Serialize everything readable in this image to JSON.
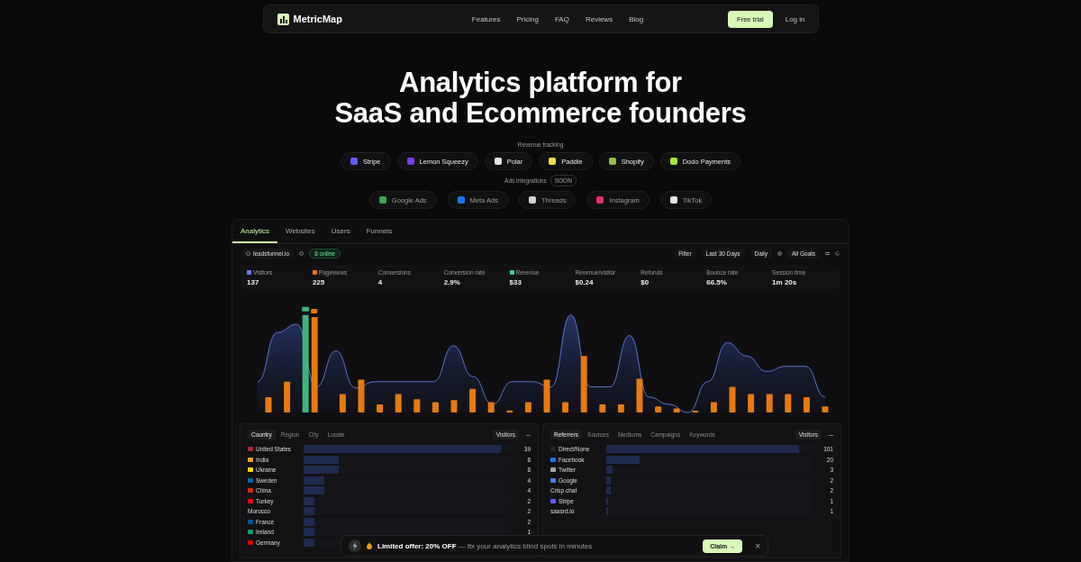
{
  "nav": {
    "brand": "MetricMap",
    "links": [
      "Features",
      "Pricing",
      "FAQ",
      "Reviews",
      "Blog"
    ],
    "cta": "Free trial",
    "login": "Log in"
  },
  "hero": {
    "title_lines": [
      "Analytics platform for",
      "SaaS and Ecommerce founders"
    ],
    "revenue_label": "Revenue tracking",
    "revenue_integrations": [
      {
        "name": "Stripe",
        "color": "#635bff"
      },
      {
        "name": "Lemon Squeezy",
        "color": "#7c3aed"
      },
      {
        "name": "Polar",
        "color": "#e5e5e5"
      },
      {
        "name": "Paddle",
        "color": "#fde047"
      },
      {
        "name": "Shopify",
        "color": "#95bf47"
      },
      {
        "name": "Dodo Payments",
        "color": "#a3e635"
      }
    ],
    "ads_label": "Ads integrations",
    "ads_badge": "SOON",
    "ads_integrations": [
      {
        "name": "Google Ads",
        "color": "#34a853"
      },
      {
        "name": "Meta Ads",
        "color": "#1877f2"
      },
      {
        "name": "Threads",
        "color": "#d4d4d4"
      },
      {
        "name": "Instagram",
        "color": "#e1306c"
      },
      {
        "name": "TikTok",
        "color": "#e5e5e5"
      }
    ]
  },
  "dashboard": {
    "tabs": [
      {
        "label": "Analytics",
        "selected": true
      },
      {
        "label": "Websites",
        "selected": false
      },
      {
        "label": "Users",
        "selected": false
      },
      {
        "label": "Funnels",
        "selected": false
      }
    ],
    "toolbar": {
      "site": "leadsfunnel.io",
      "online": "8 online",
      "filter": "Filter",
      "range": "Last 30 Days",
      "interval": "Daily",
      "goals": "All Goals"
    },
    "metrics": [
      {
        "label": "Visitors",
        "value": "137",
        "color": "#6b7cff"
      },
      {
        "label": "Pageviews",
        "value": "225",
        "color": "#f97316"
      },
      {
        "label": "Conversions",
        "value": "4"
      },
      {
        "label": "Conversion rate",
        "value": "2.9%"
      },
      {
        "label": "Revenue",
        "value": "$33",
        "color": "#34d399"
      },
      {
        "label": "Revenue/visitor",
        "value": "$0.24"
      },
      {
        "label": "Refunds",
        "value": "$0"
      },
      {
        "label": "Bounce rate",
        "value": "66.5%"
      },
      {
        "label": "Session time",
        "value": "1m 20s"
      }
    ],
    "breakdowns": [
      {
        "tabs": [
          {
            "label": "Country",
            "selected": true
          },
          {
            "label": "Region",
            "selected": false
          },
          {
            "label": "City",
            "selected": false
          },
          {
            "label": "Locale",
            "selected": false
          }
        ],
        "column": "Visitors",
        "rows": [
          {
            "name": "United States",
            "value": "39",
            "level": 0.95,
            "color": "#b22234"
          },
          {
            "name": "India",
            "value": "8",
            "level": 0.17,
            "color": "#ff9933"
          },
          {
            "name": "Ukraine",
            "value": "8",
            "level": 0.17,
            "color": "#ffd500"
          },
          {
            "name": "Sweden",
            "value": "4",
            "level": 0.1,
            "color": "#006aa7"
          },
          {
            "name": "China",
            "value": "4",
            "level": 0.1,
            "color": "#de2910"
          },
          {
            "name": "Turkey",
            "value": "2",
            "level": 0.05,
            "color": "#e30a17"
          },
          {
            "name": "Morocco",
            "value": "2",
            "level": 0.05
          },
          {
            "name": "France",
            "value": "2",
            "level": 0.05,
            "color": "#0055a4"
          },
          {
            "name": "Ireland",
            "value": "1",
            "level": 0.05,
            "color": "#169b62"
          },
          {
            "name": "Germany",
            "level": 0.05,
            "color": "#dd0000"
          }
        ]
      },
      {
        "tabs": [
          {
            "label": "Referrers",
            "selected": true
          },
          {
            "label": "Sources",
            "selected": false
          },
          {
            "label": "Mediums",
            "selected": false
          },
          {
            "label": "Campaigns",
            "selected": false
          },
          {
            "label": "Keywords",
            "selected": false
          }
        ],
        "column": "Visitors",
        "rows": [
          {
            "name": "Direct/None",
            "value": "101",
            "level": 0.93,
            "color": "#262626"
          },
          {
            "name": "Facebook",
            "value": "20",
            "level": 0.16,
            "color": "#1877f2"
          },
          {
            "name": "Twitter",
            "value": "3",
            "level": 0.03,
            "color": "#a3a3a3"
          },
          {
            "name": "Google",
            "value": "2",
            "level": 0.02,
            "color": "#4285f4"
          },
          {
            "name": "Crisp.chat",
            "value": "2",
            "level": 0.02
          },
          {
            "name": "Stripe",
            "value": "1",
            "level": 0.01,
            "color": "#635bff"
          },
          {
            "name": "saasrd.io",
            "value": "1",
            "level": 0.01
          }
        ]
      }
    ]
  },
  "offer": {
    "text": "**Limited offer: 20% OFF** — fix your analytics blind spots in minutes",
    "button": "Claim →",
    "close": "×"
  }
}
